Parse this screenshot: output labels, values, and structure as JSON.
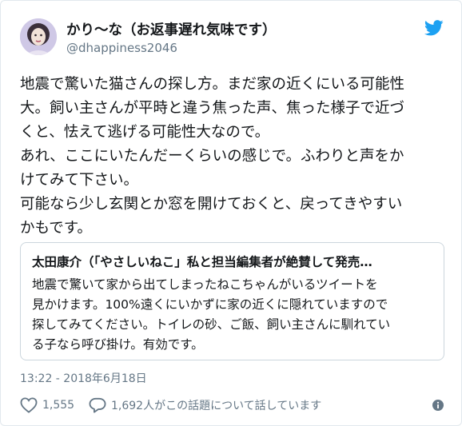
{
  "user": {
    "display_name": "かり〜な（お返事遅れ気味です）",
    "handle": "@dhappiness2046"
  },
  "tweet": {
    "lines": [
      "地震で驚いた猫さんの探し方。まだ家の近くにいる可能性",
      "大。飼い主さんが平時と違う焦った声、焦った様子で近づ",
      "くと、怯えて逃げる可能性大なので。",
      "あれ、ここにいたんだーくらいの感じで。ふわりと声をか",
      "けてみて下さい。",
      "可能なら少し玄関とか窓を開けておくと、戻ってきやすい",
      "かもです。"
    ]
  },
  "quote": {
    "title": "太田康介（「やさしいねこ」私と担当編集者が絶賛して発売…",
    "lines": [
      "地震で驚いて家から出てしまったねこちゃんがいるツイートを",
      "見かけます。100%遠くにいかずに家の近くに隠れていますので",
      "探してみてください。トイレの砂、ご飯、飼い主さんに馴れてい",
      "る子なら呼び掛け。有効です。"
    ]
  },
  "timestamp": "13:22 - 2018年6月18日",
  "stats": {
    "likes": "1,555",
    "replies_text": "1,692人がこの話題について話しています"
  },
  "icons": {
    "brand": "twitter-bird-icon",
    "like": "heart-icon",
    "reply": "speech-bubble-icon",
    "info": "info-icon"
  },
  "colors": {
    "brand_blue": "#1da1f2",
    "secondary_text": "#657786",
    "border": "#ccd6dd"
  }
}
